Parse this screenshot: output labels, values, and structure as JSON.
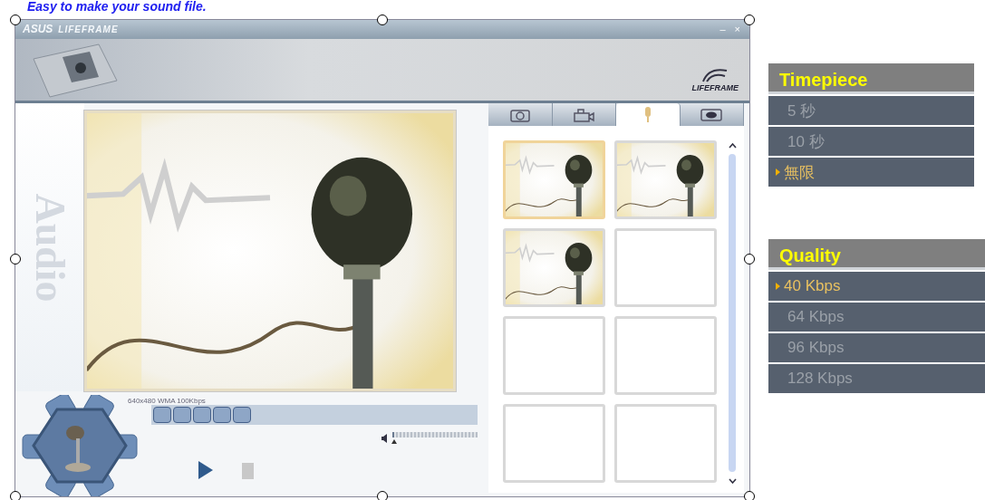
{
  "headline": "Easy to make your sound file.",
  "window": {
    "brand": "ASUS",
    "title": "LIFEFRAME",
    "logo": "LIFEFRAME",
    "close": "×",
    "minimize": "–"
  },
  "side_label": "Audio",
  "preview": {
    "kind": "picture",
    "caption": "640x480 WMA 100Kbps"
  },
  "tabs": [
    {
      "kind": "camera",
      "selected": false
    },
    {
      "kind": "video",
      "selected": false
    },
    {
      "kind": "audio",
      "selected": true
    },
    {
      "kind": "eye",
      "selected": false
    }
  ],
  "thumbnails": [
    {
      "filled": true,
      "selected": true
    },
    {
      "filled": true,
      "selected": false
    },
    {
      "filled": true,
      "selected": false
    },
    {
      "filled": false,
      "selected": false
    },
    {
      "filled": false,
      "selected": false
    },
    {
      "filled": false,
      "selected": false
    },
    {
      "filled": false,
      "selected": false
    },
    {
      "filled": false,
      "selected": false
    }
  ],
  "volume": {
    "level": 0.02
  },
  "menus": [
    {
      "title": "Timepiece",
      "items": [
        {
          "label": "5 秒",
          "selected": false
        },
        {
          "label": "10 秒",
          "selected": false
        },
        {
          "label": "無限",
          "selected": true
        }
      ]
    },
    {
      "title": "Quality",
      "items": [
        {
          "label": "40 Kbps",
          "selected": true
        },
        {
          "label": "64 Kbps",
          "selected": false
        },
        {
          "label": "96 Kbps",
          "selected": false
        },
        {
          "label": "128 Kbps",
          "selected": false
        }
      ]
    }
  ]
}
